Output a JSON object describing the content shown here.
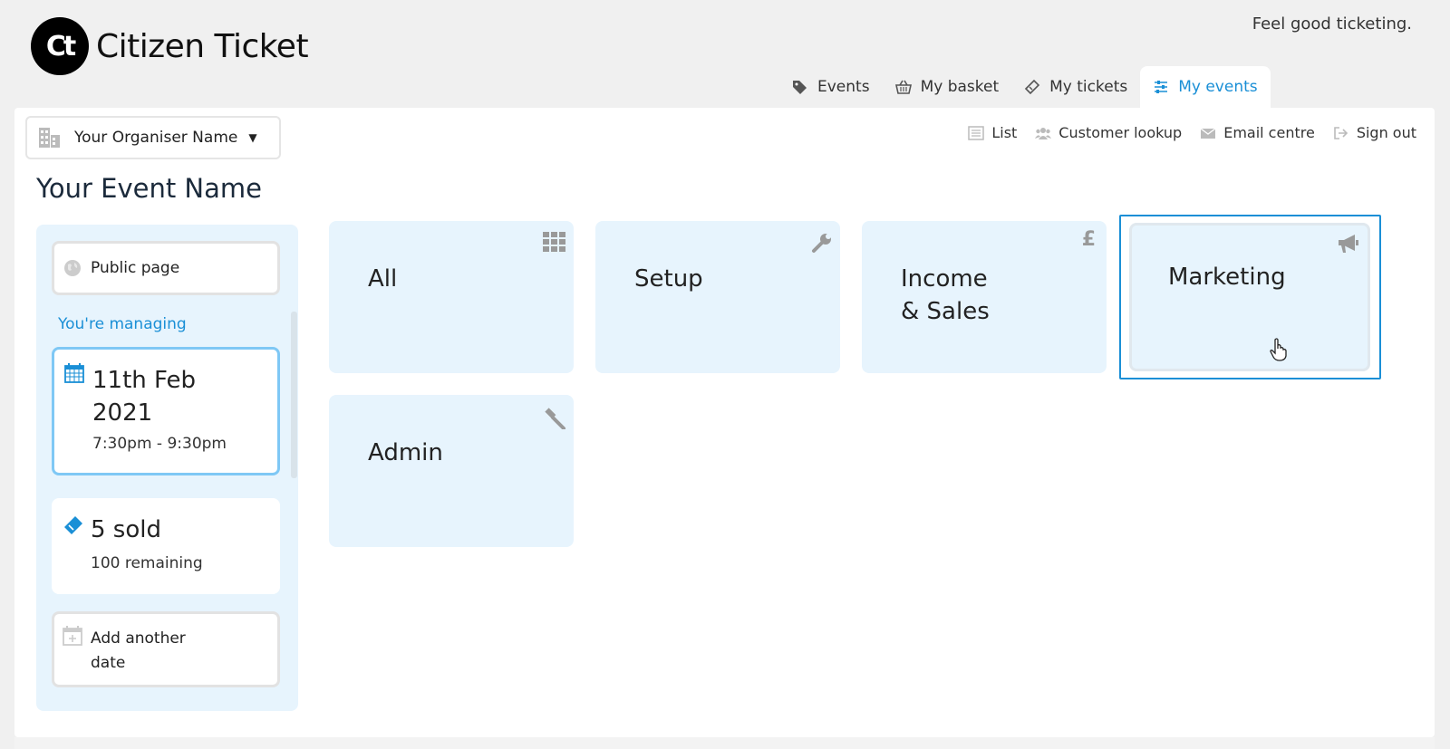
{
  "header": {
    "logo_mark": "Ct",
    "logo_text": "Citizen Ticket",
    "tagline": "Feel good ticketing."
  },
  "tabs": [
    {
      "label": "Events",
      "icon": "tags-icon",
      "active": false
    },
    {
      "label": "My basket",
      "icon": "basket-icon",
      "active": false
    },
    {
      "label": "My tickets",
      "icon": "ticket-icon",
      "active": false
    },
    {
      "label": "My events",
      "icon": "sliders-icon",
      "active": true
    }
  ],
  "organiser": {
    "name": "Your Organiser Name"
  },
  "util_links": [
    {
      "label": "List",
      "icon": "list-icon"
    },
    {
      "label": "Customer lookup",
      "icon": "users-icon"
    },
    {
      "label": "Email centre",
      "icon": "envelope-icon"
    },
    {
      "label": "Sign out",
      "icon": "sign-out-icon"
    }
  ],
  "page": {
    "title": "Your Event Name"
  },
  "sidebar": {
    "public_page": "Public page",
    "managing_label": "You're managing",
    "date": {
      "day": "11th Feb",
      "year": "2021",
      "time": "7:30pm - 9:30pm"
    },
    "sales": {
      "sold": "5 sold",
      "remaining": "100 remaining"
    },
    "add_date": {
      "line1": "Add another",
      "line2": "date"
    }
  },
  "tiles": {
    "all": {
      "label": "All",
      "icon": "grid-icon"
    },
    "setup": {
      "label": "Setup",
      "icon": "wrench-icon"
    },
    "income": {
      "line1": "Income",
      "line2": "& Sales",
      "icon": "pound-icon"
    },
    "marketing": {
      "label": "Marketing",
      "icon": "megaphone-icon",
      "selected": true
    },
    "admin": {
      "label": "Admin",
      "icon": "gavel-icon"
    }
  },
  "colors": {
    "accent": "#1a8fd6",
    "tile_bg": "#e7f4fd",
    "page_bg": "#f0f0f0"
  }
}
